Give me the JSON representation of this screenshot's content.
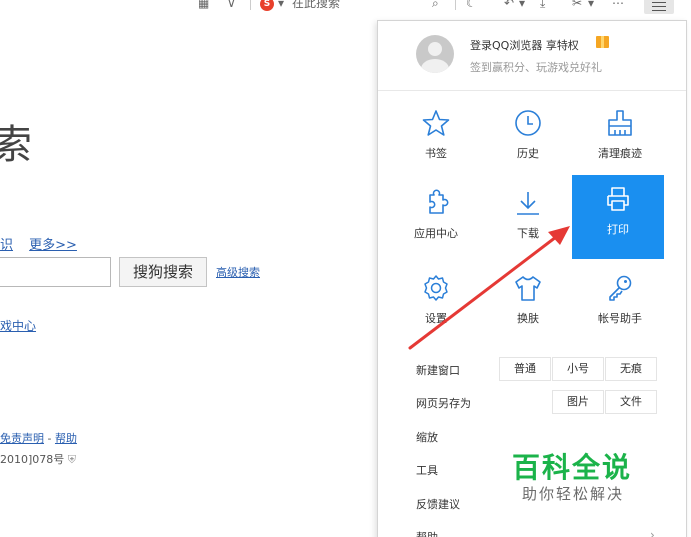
{
  "toolbar": {
    "search_engine_label": "在此搜索",
    "sogou_letter": "S"
  },
  "background_page": {
    "title": "索",
    "links": [
      "识",
      "更多>>"
    ],
    "search_button": "搜狗搜索",
    "advanced_search": "高级搜索",
    "game_center": "戏中心",
    "disclaimer": "免责声明",
    "disclaimer_sep": " - ",
    "help": "帮助",
    "icp": "2010]078号"
  },
  "menu": {
    "login_text": "登录QQ浏览器 享特权",
    "login_sub": "签到赢积分、玩游戏兑好礼",
    "grid": [
      {
        "label": "书签",
        "icon": "star-icon"
      },
      {
        "label": "历史",
        "icon": "clock-icon"
      },
      {
        "label": "清理痕迹",
        "icon": "broom-icon"
      },
      {
        "label": "应用中心",
        "icon": "puzzle-icon"
      },
      {
        "label": "下载",
        "icon": "download-icon"
      },
      {
        "label": "打印",
        "icon": "printer-icon"
      },
      {
        "label": "设置",
        "icon": "gear-icon"
      },
      {
        "label": "换肤",
        "icon": "shirt-icon"
      },
      {
        "label": "帐号助手",
        "icon": "key-icon"
      }
    ],
    "new_window": {
      "label": "新建窗口",
      "options": [
        "普通",
        "小号",
        "无痕"
      ]
    },
    "save_as": {
      "label": "网页另存为",
      "options": [
        "图片",
        "文件"
      ]
    },
    "zoom": {
      "label": "缩放"
    },
    "tools": {
      "label": "工具"
    },
    "feedback": {
      "label": "反馈建议"
    },
    "help": {
      "label": "帮助"
    }
  },
  "watermark": {
    "main": "百科全说",
    "sub": "助你轻松解决"
  },
  "colors": {
    "accent_blue": "#1a8ff0",
    "icon_blue": "#2b7fd8",
    "arrow_red": "#e53935",
    "watermark_green": "#1bb34a"
  }
}
